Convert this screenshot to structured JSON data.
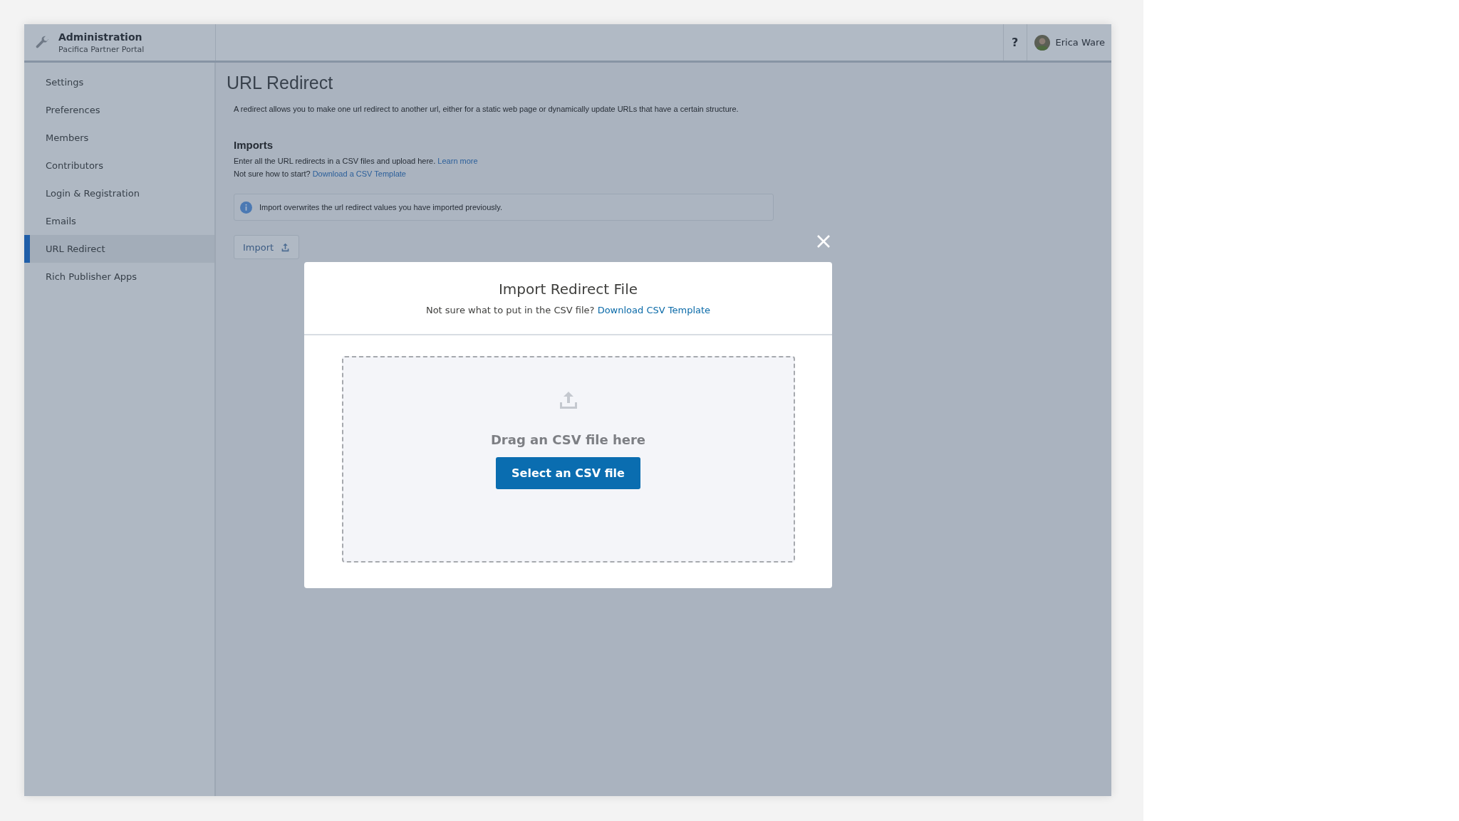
{
  "header": {
    "title": "Administration",
    "subtitle": "Pacifica Partner Portal",
    "help": "?",
    "user": "Erica Ware"
  },
  "sidebar": {
    "items": [
      {
        "label": "Settings",
        "selected": false
      },
      {
        "label": "Preferences",
        "selected": false
      },
      {
        "label": "Members",
        "selected": false
      },
      {
        "label": "Contributors",
        "selected": false
      },
      {
        "label": "Login & Registration",
        "selected": false
      },
      {
        "label": "Emails",
        "selected": false
      },
      {
        "label": "URL Redirect",
        "selected": true
      },
      {
        "label": "Rich Publisher Apps",
        "selected": false
      }
    ]
  },
  "page": {
    "title": "URL Redirect",
    "description": "A redirect allows you to make one url redirect to another url, either for a static web page or dynamically update URLs that have a certain structure.",
    "imports": {
      "heading": "Imports",
      "line_1": "Enter all the URL redirects in a CSV files and upload here.",
      "line_1_link": "Learn more",
      "line_2": "Not sure how to start?",
      "line_2_link": "Download a CSV Template",
      "notice": "Import overwrites the url redirect values you have imported previously.",
      "import_button": "Import"
    }
  },
  "modal": {
    "title": "Import Redirect File",
    "subtitle": "Not sure what to put in the CSV file?",
    "subtitle_link": "Download CSV Template",
    "drop_text": "Drag an CSV file here",
    "select_button": "Select an CSV file"
  }
}
